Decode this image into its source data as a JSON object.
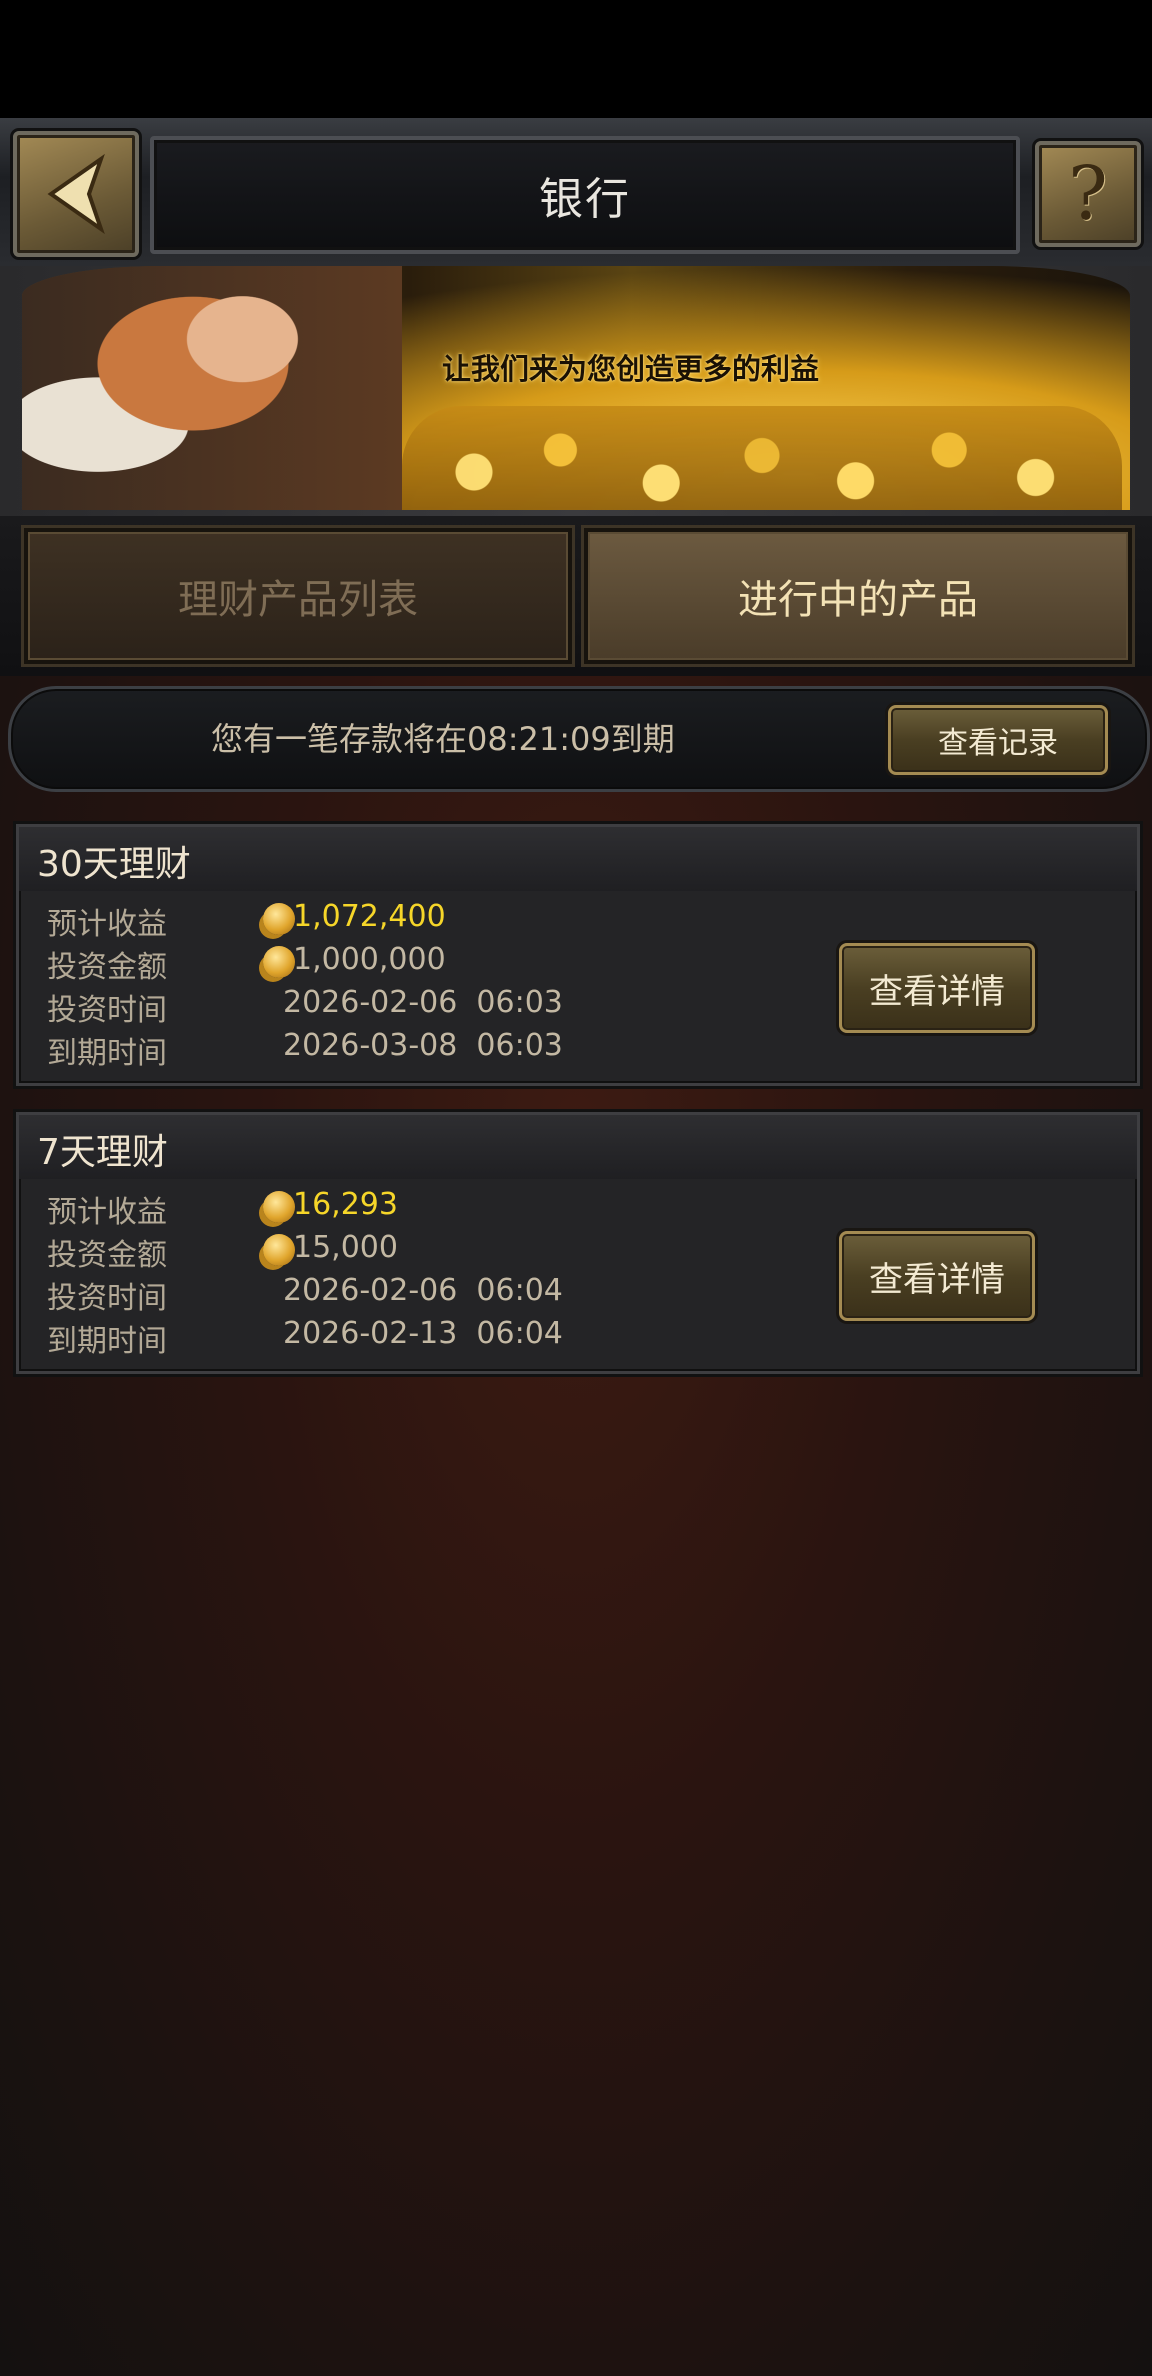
{
  "header": {
    "title": "银行",
    "back_icon": "chevron-left-icon",
    "help_icon": "question-icon"
  },
  "banner": {
    "slogan": "让我们来为您创造更多的利益"
  },
  "tabs": [
    {
      "label": "理财产品列表",
      "active": false
    },
    {
      "label": "进行中的产品",
      "active": true
    }
  ],
  "notice": {
    "text": "您有一笔存款将在08:21:09到期",
    "records_button": "查看记录"
  },
  "products": [
    {
      "title": "30天理财",
      "expected_label": "预计收益",
      "expected_value": "1,072,400",
      "amount_label": "投资金额",
      "amount_value": "1,000,000",
      "invest_time_label": "投资时间",
      "invest_time": "2026-02-06  06:03",
      "expire_time_label": "到期时间",
      "expire_time": "2026-03-08  06:03",
      "details_button": "查看详情"
    },
    {
      "title": "7天理财",
      "expected_label": "预计收益",
      "expected_value": "16,293",
      "amount_label": "投资金额",
      "amount_value": "15,000",
      "invest_time_label": "投资时间",
      "invest_time": "2026-02-06  06:04",
      "expire_time_label": "到期时间",
      "expire_time": "2026-02-13  06:04",
      "details_button": "查看详情"
    }
  ],
  "colors": {
    "gold_value": "#f6d629",
    "label": "#b3a996",
    "active_tab_text": "#f3e2b5"
  }
}
